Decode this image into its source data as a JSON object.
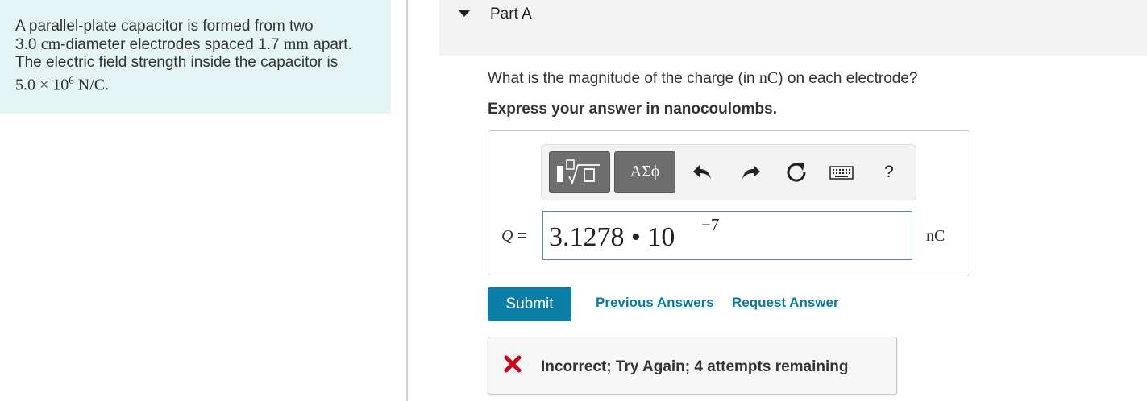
{
  "problem": {
    "line1": "A parallel-plate capacitor is formed from two",
    "line2_num": "3.0",
    "line2_unit": "cm",
    "line2_rest": "-diameter electrodes spaced 1.7",
    "line2_unit2": "mm",
    "line2_end": "apart.",
    "line3": "The electric field strength inside the capacitor is",
    "line4_value": "5.0 × 10",
    "line4_exp": "6",
    "line4_unit": "N/C."
  },
  "part": {
    "title": "Part A"
  },
  "question": {
    "text_before": "What is the magnitude of the charge (in ",
    "unit": "nC",
    "text_after": ") on each electrode?",
    "instruction": "Express your answer in nanocoulombs."
  },
  "toolbar": {
    "symbols_label": "ΑΣϕ",
    "help_label": "?",
    "icons": [
      "templates-icon",
      "symbols-icon",
      "undo-icon",
      "redo-icon",
      "reset-icon",
      "keyboard-icon",
      "help-icon"
    ]
  },
  "answer": {
    "variable": "Q",
    "equals": "=",
    "value": "3.1278 • 10",
    "exponent": "−7",
    "unit": "nC"
  },
  "actions": {
    "submit_label": "Submit",
    "previous_answers_label": "Previous Answers",
    "request_answer_label": "Request Answer"
  },
  "feedback": {
    "text": "Incorrect; Try Again; 4 attempts remaining",
    "icon": "x-icon",
    "icon_color": "#d0021b"
  },
  "colors": {
    "problem_bg": "#e5f4f4",
    "accent": "#097ea7",
    "link": "#0a7aa3"
  }
}
